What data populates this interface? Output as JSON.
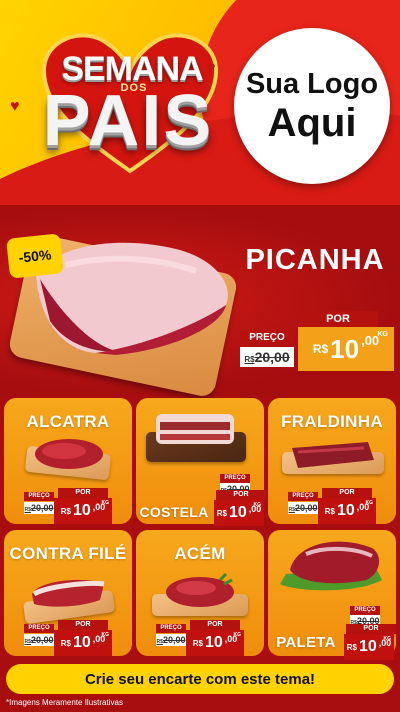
{
  "header": {
    "title_top": "SEMANA",
    "title_mid": "DOS",
    "title_main": "PAIS",
    "logo_line1": "Sua Logo",
    "logo_line2": "Aqui"
  },
  "hero": {
    "discount": "-50%",
    "name": "PICANHA",
    "preco_label": "PREÇO",
    "por_label": "POR",
    "old_price_currency": "R$",
    "old_price": "20,00",
    "currency": "R$",
    "price_int": "10",
    "price_cents": ",00",
    "unit": "KG"
  },
  "products": [
    {
      "name": "ALCATRA",
      "preco_label": "PREÇO",
      "por_label": "POR",
      "old_price_currency": "R$",
      "old_price": "20,00",
      "currency": "R$",
      "price_int": "10",
      "price_cents": ",00",
      "unit": "KG"
    },
    {
      "name": "COSTELA",
      "preco_label": "PREÇO",
      "por_label": "POR",
      "old_price_currency": "R$",
      "old_price": "20,00",
      "currency": "R$",
      "price_int": "10",
      "price_cents": ",00",
      "unit": "KG"
    },
    {
      "name": "FRALDINHA",
      "preco_label": "PREÇO",
      "por_label": "POR",
      "old_price_currency": "R$",
      "old_price": "20,00",
      "currency": "R$",
      "price_int": "10",
      "price_cents": ",00",
      "unit": "KG"
    },
    {
      "name": "CONTRA FILÉ",
      "preco_label": "PREÇO",
      "por_label": "POR",
      "old_price_currency": "R$",
      "old_price": "20,00",
      "currency": "R$",
      "price_int": "10",
      "price_cents": ",00",
      "unit": "KG"
    },
    {
      "name": "ACÉM",
      "preco_label": "PREÇO",
      "por_label": "POR",
      "old_price_currency": "R$",
      "old_price": "20,00",
      "currency": "R$",
      "price_int": "10",
      "price_cents": ",00",
      "unit": "KG"
    },
    {
      "name": "PALETA",
      "preco_label": "PREÇO",
      "por_label": "POR",
      "old_price_currency": "R$",
      "old_price": "20,00",
      "currency": "R$",
      "price_int": "10",
      "price_cents": ",00",
      "unit": "KG"
    }
  ],
  "footer": {
    "cta": "Crie seu encarte com este tema!",
    "disclaimer": "*Imagens Meramente Ilustrativas"
  },
  "colors": {
    "brand_red": "#c1110e",
    "brand_yellow": "#ffd200",
    "card_orange": "#f7a81c",
    "price_orange": "#f4a11a"
  }
}
